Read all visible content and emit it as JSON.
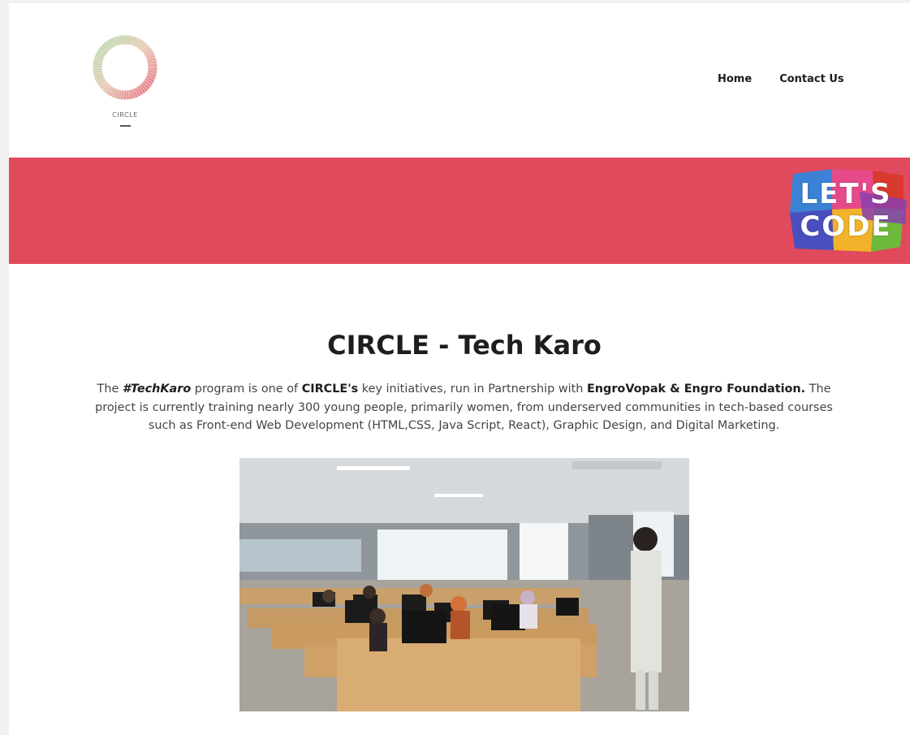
{
  "header": {
    "logo_text": "CIRCLE",
    "nav": [
      {
        "label": "Home"
      },
      {
        "label": "Contact Us"
      }
    ]
  },
  "banner": {
    "color": "#e04a5c",
    "badge_line1": "LET'S",
    "badge_line2": "CODE"
  },
  "main": {
    "title": "CIRCLE - Tech Karo",
    "description": {
      "p1": "The ",
      "b1": "#TechKaro",
      "p2": " program is one of ",
      "b2": "CIRCLE's",
      "p3": " key initiatives, run in Partnership with ",
      "b3": "EngroVopak & Engro Foundation.",
      "p4": " The project is currently training nearly 300 young people, primarily women, from underserved communities in tech-based courses such as Front-end Web Development (HTML,CSS, Java Script, React), Graphic Design, and Digital Marketing."
    }
  }
}
